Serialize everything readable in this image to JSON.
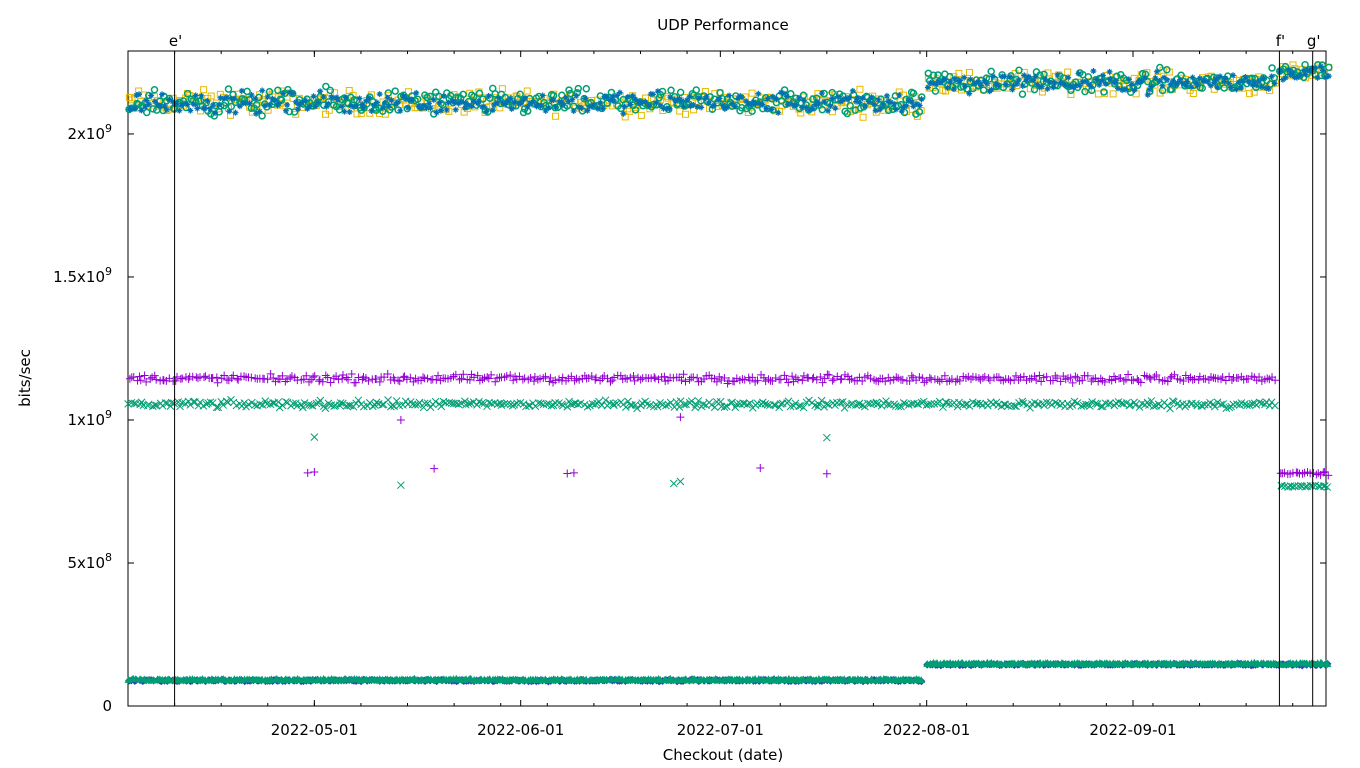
{
  "chart_data": {
    "type": "scatter",
    "title": "UDP Performance",
    "xlabel": "Checkout (date)",
    "ylabel": "bits/sec",
    "x_range": [
      "2022-04-03",
      "2022-09-30"
    ],
    "xlim": [
      "2022-04-03",
      "2022-09-30"
    ],
    "ylim": [
      0,
      2290000000
    ],
    "x_ticks": [
      "2022-05-01",
      "2022-06-01",
      "2022-07-01",
      "2022-08-01",
      "2022-09-01"
    ],
    "y_ticks": [
      {
        "value": 0,
        "label": "0"
      },
      {
        "value": 500000000,
        "label": "5x10",
        "exp": "8"
      },
      {
        "value": 1000000000,
        "label": "1x10",
        "exp": "9"
      },
      {
        "value": 1500000000,
        "label": "1.5x10",
        "exp": "9"
      },
      {
        "value": 2000000000,
        "label": "2x10",
        "exp": "9"
      }
    ],
    "grid": false,
    "markers": [
      {
        "label": "e'",
        "date": "2022-04-10"
      },
      {
        "label": "f'",
        "date": "2022-09-23"
      },
      {
        "label": "g'",
        "date": "2022-09-28"
      }
    ],
    "series": [
      {
        "marker": "square",
        "color": "#e6b800",
        "segments": [
          {
            "from": "2022-04-03",
            "to": "2022-07-31",
            "mean": 2110000000,
            "spread": 60000000
          },
          {
            "from": "2022-08-01",
            "to": "2022-09-22",
            "mean": 2180000000,
            "spread": 55000000
          },
          {
            "from": "2022-09-23",
            "to": "2022-09-30",
            "mean": 2210000000,
            "spread": 40000000
          }
        ]
      },
      {
        "marker": "circle",
        "color": "#009e73",
        "segments": [
          {
            "from": "2022-04-03",
            "to": "2022-07-31",
            "mean": 2110000000,
            "spread": 65000000
          },
          {
            "from": "2022-08-01",
            "to": "2022-09-22",
            "mean": 2180000000,
            "spread": 60000000
          },
          {
            "from": "2022-09-23",
            "to": "2022-09-30",
            "mean": 2220000000,
            "spread": 45000000
          }
        ]
      },
      {
        "marker": "star",
        "color": "#0072b2",
        "segments": [
          {
            "from": "2022-04-03",
            "to": "2022-07-31",
            "mean": 2110000000,
            "spread": 55000000
          },
          {
            "from": "2022-08-01",
            "to": "2022-09-22",
            "mean": 2180000000,
            "spread": 50000000
          },
          {
            "from": "2022-09-23",
            "to": "2022-09-30",
            "mean": 2215000000,
            "spread": 40000000
          }
        ]
      },
      {
        "marker": "plus",
        "color": "#9400d3",
        "segments": [
          {
            "from": "2022-04-03",
            "to": "2022-09-22",
            "mean": 1145000000,
            "spread": 20000000
          },
          {
            "from": "2022-09-23",
            "to": "2022-09-30",
            "mean": 812000000,
            "spread": 8000000
          }
        ],
        "outliers": [
          {
            "x": "2022-04-30",
            "y": 815000000
          },
          {
            "x": "2022-05-01",
            "y": 818000000
          },
          {
            "x": "2022-05-14",
            "y": 1000000000
          },
          {
            "x": "2022-05-19",
            "y": 830000000
          },
          {
            "x": "2022-06-08",
            "y": 813000000
          },
          {
            "x": "2022-06-09",
            "y": 815000000
          },
          {
            "x": "2022-06-25",
            "y": 1010000000
          },
          {
            "x": "2022-07-07",
            "y": 832000000
          },
          {
            "x": "2022-07-17",
            "y": 812000000
          }
        ]
      },
      {
        "marker": "cross",
        "color": "#009e73",
        "segments": [
          {
            "from": "2022-04-03",
            "to": "2022-09-22",
            "mean": 1055000000,
            "spread": 18000000
          },
          {
            "from": "2022-09-23",
            "to": "2022-09-30",
            "mean": 768000000,
            "spread": 6000000
          }
        ],
        "outliers": [
          {
            "x": "2022-05-01",
            "y": 940000000
          },
          {
            "x": "2022-05-14",
            "y": 772000000
          },
          {
            "x": "2022-06-24",
            "y": 778000000
          },
          {
            "x": "2022-06-25",
            "y": 785000000
          },
          {
            "x": "2022-07-17",
            "y": 938000000
          }
        ]
      },
      {
        "marker": "diamond-filled",
        "color": "#3a3ac8",
        "segments": [
          {
            "from": "2022-04-03",
            "to": "2022-07-31",
            "mean": 89000000,
            "spread": 4000000
          },
          {
            "from": "2022-08-01",
            "to": "2022-09-30",
            "mean": 145000000,
            "spread": 4000000
          }
        ]
      },
      {
        "marker": "triangle-filled",
        "color": "#009e73",
        "segments": [
          {
            "from": "2022-04-03",
            "to": "2022-07-31",
            "mean": 92000000,
            "spread": 4000000
          },
          {
            "from": "2022-08-01",
            "to": "2022-09-30",
            "mean": 148000000,
            "spread": 4000000
          }
        ]
      }
    ]
  }
}
